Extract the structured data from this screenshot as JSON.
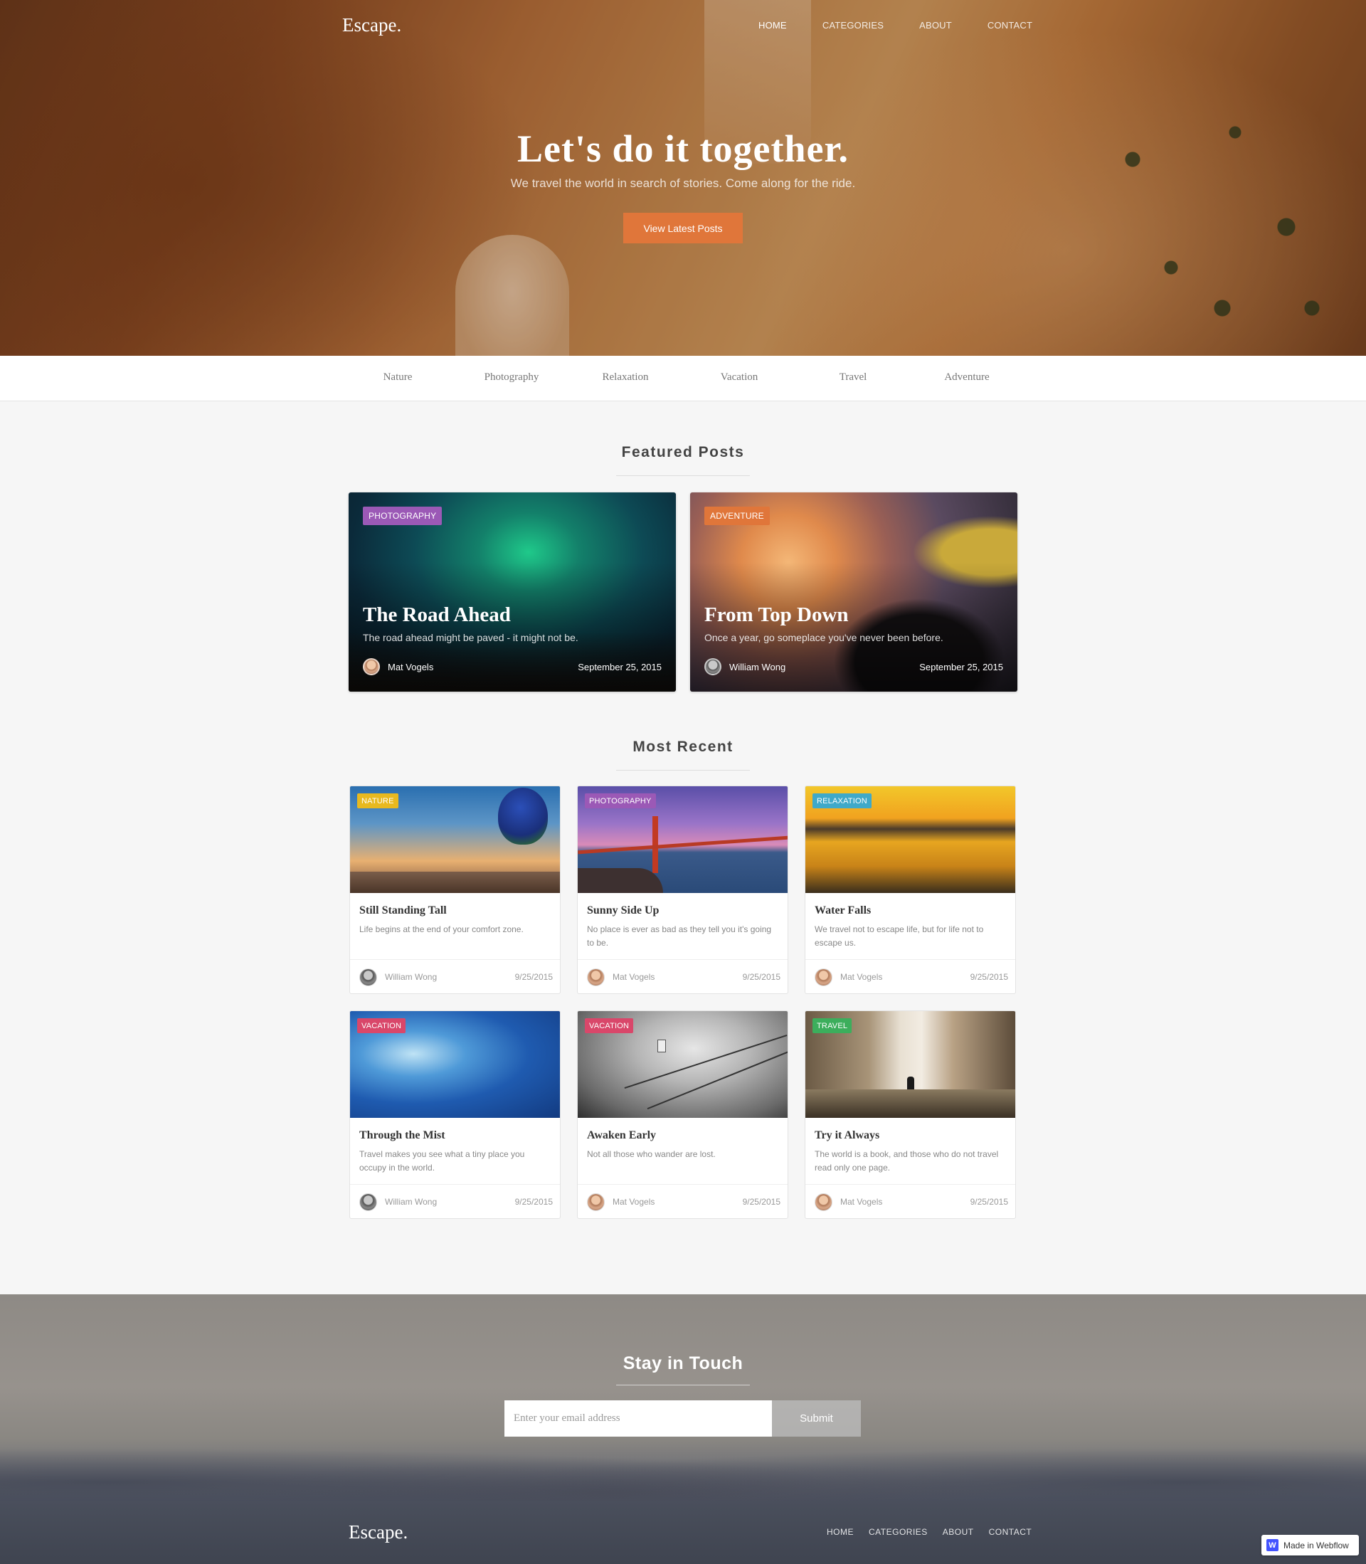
{
  "brand": "Escape.",
  "nav": [
    {
      "label": "HOME",
      "active": true
    },
    {
      "label": "CATEGORIES",
      "active": false
    },
    {
      "label": "ABOUT",
      "active": false
    },
    {
      "label": "CONTACT",
      "active": false
    }
  ],
  "hero": {
    "title": "Let's do it together.",
    "subtitle": "We travel the world in search of stories. Come along for the ride.",
    "button": "View Latest Posts"
  },
  "categories": [
    "Nature",
    "Photography",
    "Relaxation",
    "Vacation",
    "Travel",
    "Adventure"
  ],
  "featured": {
    "heading": "Featured Posts",
    "posts": [
      {
        "badge": "PHOTOGRAPHY",
        "badge_color": "#9b59b6",
        "title": "The Road Ahead",
        "excerpt": "The road ahead might be paved - it might not be.",
        "author": "Mat Vogels",
        "date": "September 25, 2015"
      },
      {
        "badge": "ADVENTURE",
        "badge_color": "#e0763a",
        "title": "From Top Down",
        "excerpt": "Once a year, go someplace you've never been before.",
        "author": "William Wong",
        "date": "September 25, 2015"
      }
    ]
  },
  "recent": {
    "heading": "Most Recent",
    "posts": [
      {
        "badge": "NATURE",
        "badge_color": "#e8b91f",
        "title": "Still Standing Tall",
        "excerpt": "Life begins at the end of your comfort zone.",
        "author": "William Wong",
        "date": "9/25/2015"
      },
      {
        "badge": "PHOTOGRAPHY",
        "badge_color": "#9b59b6",
        "title": "Sunny Side Up",
        "excerpt": "No place is ever as bad as they tell you it's going to be.",
        "author": "Mat Vogels",
        "date": "9/25/2015"
      },
      {
        "badge": "RELAXATION",
        "badge_color": "#3fa9c9",
        "title": "Water Falls",
        "excerpt": "We travel not to escape life, but for life not to escape us.",
        "author": "Mat Vogels",
        "date": "9/25/2015"
      },
      {
        "badge": "VACATION",
        "badge_color": "#d9476a",
        "title": "Through the Mist",
        "excerpt": "Travel makes you see what a tiny place you occupy in the world.",
        "author": "William Wong",
        "date": "9/25/2015"
      },
      {
        "badge": "VACATION",
        "badge_color": "#d9476a",
        "title": "Awaken Early",
        "excerpt": "Not all those who wander are lost.",
        "author": "Mat Vogels",
        "date": "9/25/2015"
      },
      {
        "badge": "TRAVEL",
        "badge_color": "#3cae5c",
        "title": "Try it Always",
        "excerpt": "The world is a book, and those who do not travel read only one page.",
        "author": "Mat Vogels",
        "date": "9/25/2015"
      }
    ]
  },
  "newsletter": {
    "title": "Stay in Touch",
    "placeholder": "Enter your email address",
    "button": "Submit"
  },
  "footer": {
    "brand": "Escape.",
    "nav": [
      "HOME",
      "CATEGORIES",
      "ABOUT",
      "CONTACT"
    ]
  },
  "webflow_badge": "Made in Webflow"
}
